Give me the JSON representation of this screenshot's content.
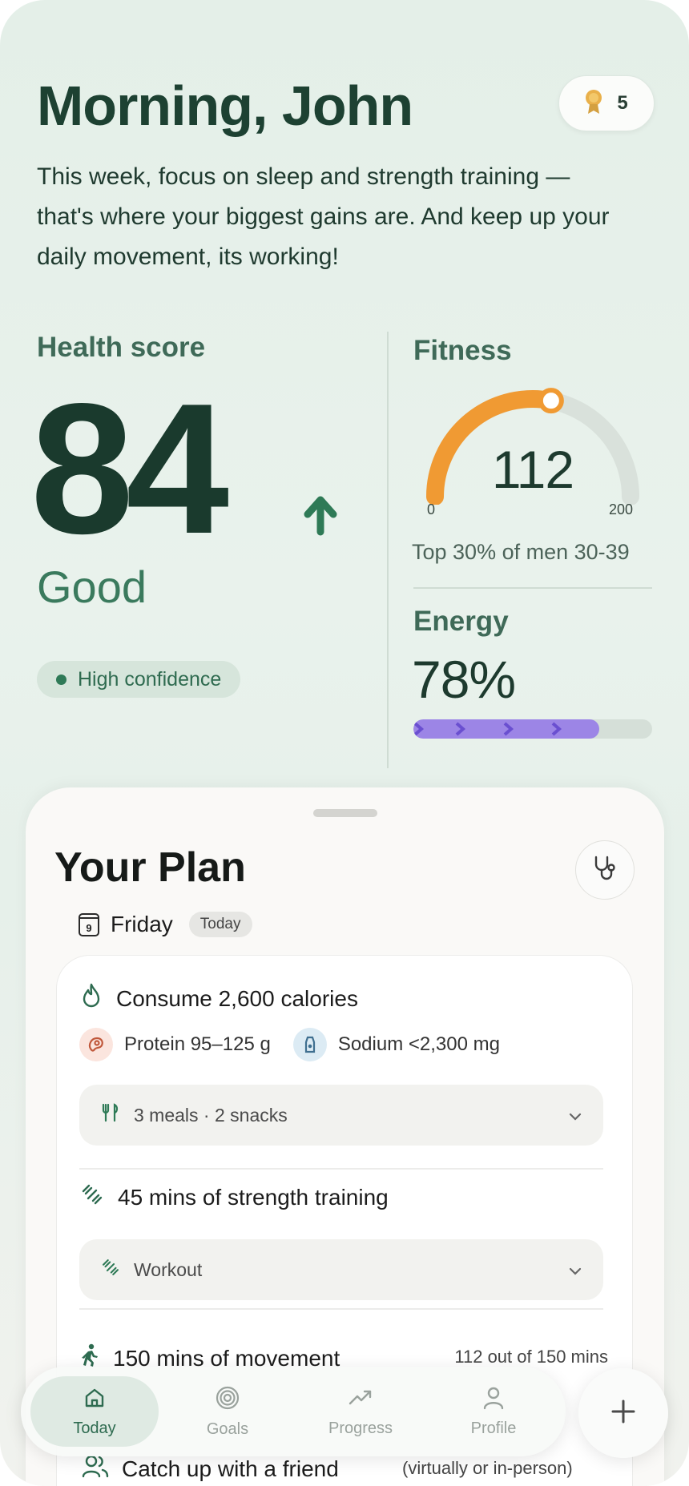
{
  "header": {
    "greeting": "Morning, John",
    "award_count": "5",
    "intro": "This week, focus on sleep and strength training — that's where your biggest gains are. And keep up your daily movement, its working!"
  },
  "health_score": {
    "title": "Health score",
    "score": "84",
    "trend": "up",
    "rating": "Good",
    "confidence": "High confidence"
  },
  "fitness": {
    "title": "Fitness",
    "value": 112,
    "value_label": "112",
    "min": "0",
    "max": "200",
    "rank": "Top 30% of men 30-39",
    "gauge_color": "#f09a33"
  },
  "energy": {
    "title": "Energy",
    "value_label": "78%",
    "fraction": 0.78,
    "bar_color": "#9c85e6"
  },
  "plan": {
    "title": "Your Plan",
    "day_number": "9",
    "day_name": "Friday",
    "today_badge": "Today",
    "calories": {
      "title": "Consume 2,600 calories",
      "protein": "Protein 95–125 g",
      "sodium": "Sodium <2,300 mg",
      "meals_label": "3 meals · 2 snacks"
    },
    "strength": {
      "title": "45 mins of strength training",
      "workout_label": "Workout"
    },
    "movement": {
      "title": "150 mins of movement",
      "progress": "112 out of 150 mins"
    },
    "friend": {
      "title": "Catch up with a friend",
      "note": "(virtually or in-person)"
    }
  },
  "nav": {
    "today": "Today",
    "goals": "Goals",
    "progress": "Progress",
    "profile": "Profile"
  },
  "colors": {
    "accent_green": "#2e6b50",
    "dark_green": "#1a3a2d",
    "orange": "#f09a33",
    "purple": "#9c85e6"
  }
}
